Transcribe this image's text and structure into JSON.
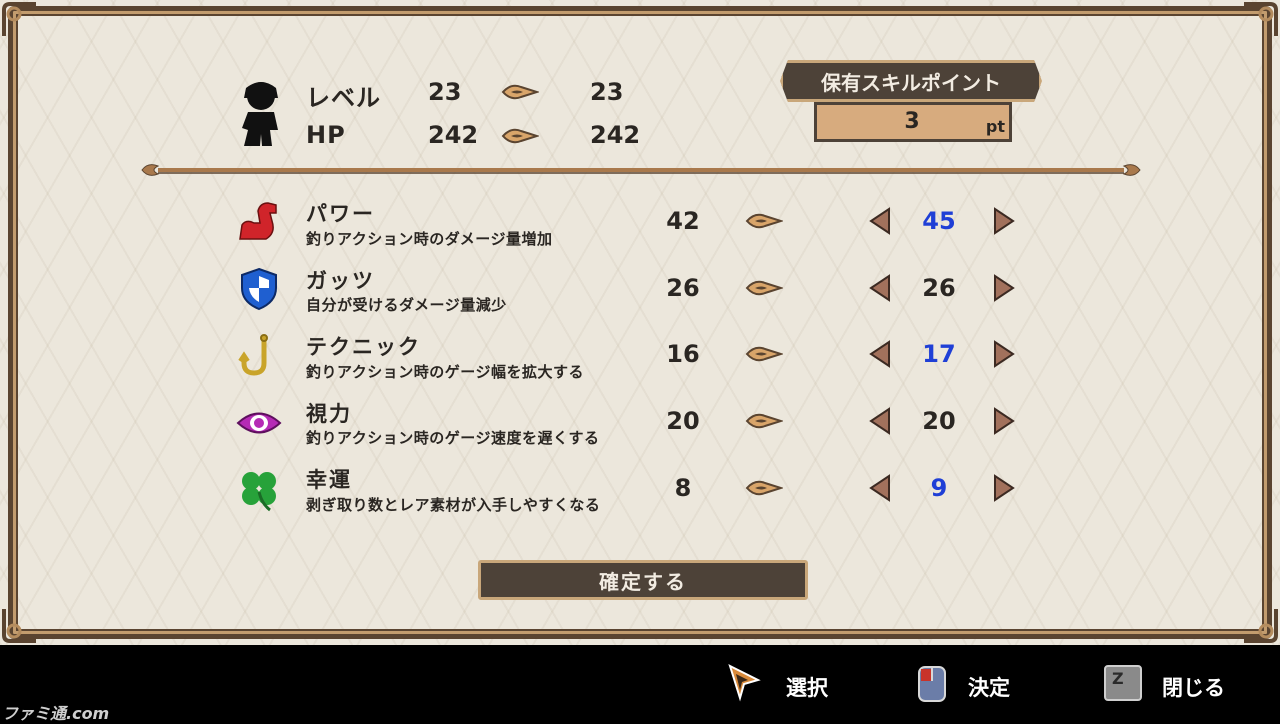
{
  "header": {
    "level_label": "レベル",
    "level_current": "23",
    "level_next": "23",
    "hp_label": "HP",
    "hp_current": "242",
    "hp_next": "242"
  },
  "skill_points": {
    "title": "保有スキルポイント",
    "value": "3",
    "unit": "pt"
  },
  "skills": [
    {
      "icon": "muscle-arm-icon",
      "name": "パワー",
      "desc": "釣りアクション時のダメージ量増加",
      "current": "42",
      "next": "45",
      "next_color": "#1f3fd6"
    },
    {
      "icon": "shield-icon",
      "name": "ガッツ",
      "desc": "自分が受けるダメージ量減少",
      "current": "26",
      "next": "26",
      "next_color": "#2a2622"
    },
    {
      "icon": "fishhook-icon",
      "name": "テクニック",
      "desc": "釣りアクション時のゲージ幅を拡大する",
      "current": "16",
      "next": "17",
      "next_color": "#1f3fd6"
    },
    {
      "icon": "eye-icon",
      "name": "視力",
      "desc": "釣りアクション時のゲージ速度を遅くする",
      "current": "20",
      "next": "20",
      "next_color": "#2a2622"
    },
    {
      "icon": "clover-icon",
      "name": "幸運",
      "desc": "剥ぎ取り数とレア素材が入手しやすくなる",
      "current": "8",
      "next": "9",
      "next_color": "#1f3fd6"
    }
  ],
  "confirm_label": "確定する",
  "footer": {
    "select_label": "選択",
    "decide_label": "決定",
    "close_label": "閉じる",
    "close_key": "Z"
  },
  "watermark": "ファミ通.com",
  "colors": {
    "panel_bg": "#ece7dc",
    "frame": "#5a4430",
    "accent_gold": "#c9a77a",
    "increase_blue": "#1f3fd6"
  }
}
